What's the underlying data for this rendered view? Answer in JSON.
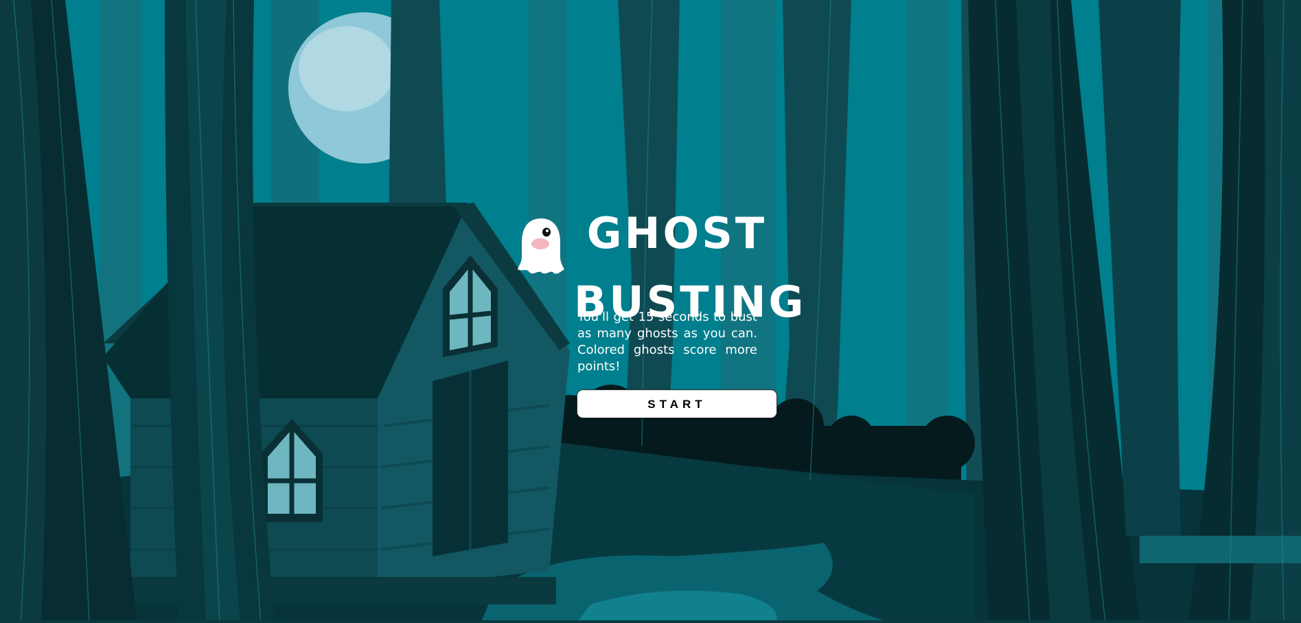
{
  "game": {
    "title_line1": "GHOST",
    "title_line2": "BUSTING",
    "description": "You'll get 15 seconds to bust as many ghosts as you can. Colored ghosts score more points!",
    "start_label": "START",
    "ghost_icon": "ghost-icon"
  },
  "colors": {
    "sky": "#007f8e",
    "moon": "#8fc8d8",
    "tree_dark": "#0d3a40",
    "button_bg": "#ffffff",
    "title_text": "#ffffff"
  }
}
